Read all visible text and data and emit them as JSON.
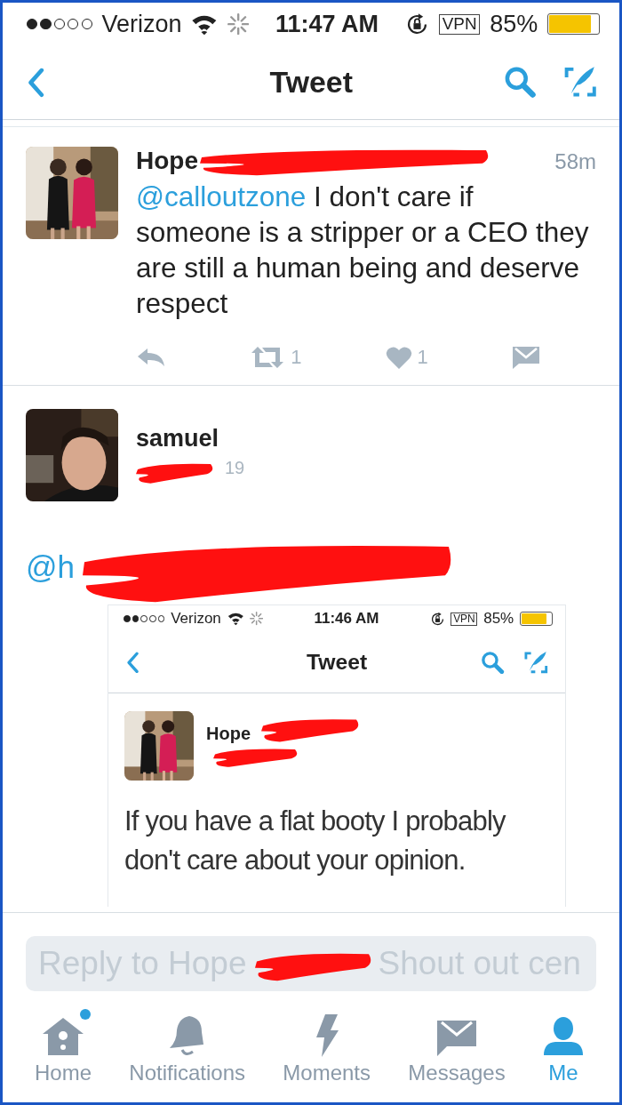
{
  "status_bar": {
    "carrier": "Verizon",
    "time": "11:47 AM",
    "vpn": "VPN",
    "battery": "85%"
  },
  "nav_bar": {
    "title": "Tweet"
  },
  "main_tweet": {
    "name": "Hope",
    "time": "58m",
    "mention": "@calloutzone",
    "text": " I don't care if\nsomeone is a stripper or a CEO they are still a human being and deserve respect",
    "retweets": "1",
    "likes": "1"
  },
  "reply_tweet": {
    "name": "samuel",
    "handle_end": "19",
    "mention": "@h",
    "screenshot": {
      "status_bar": {
        "carrier": "Verizon",
        "time": "11:46 AM",
        "vpn": "VPN",
        "battery": "85%"
      },
      "nav_bar": {
        "title": "Tweet"
      },
      "tweet": {
        "name": "Hope",
        "text": "If you have a flat booty I probably don't care about your opinion."
      }
    }
  },
  "reply_field": {
    "placeholder": [
      "Reply to Hope",
      "Shout out cen"
    ]
  },
  "tab_bar": [
    {
      "kind": "home",
      "label": "Home",
      "selected": false,
      "new_dot": true
    },
    {
      "kind": "bell",
      "label": "Notifications",
      "selected": false,
      "new_dot": false
    },
    {
      "kind": "bolt",
      "label": "Moments",
      "selected": false,
      "new_dot": false
    },
    {
      "kind": "mail",
      "label": "Messages",
      "selected": false,
      "new_dot": false
    },
    {
      "kind": "person",
      "label": "Me",
      "selected": true,
      "new_dot": false
    }
  ]
}
